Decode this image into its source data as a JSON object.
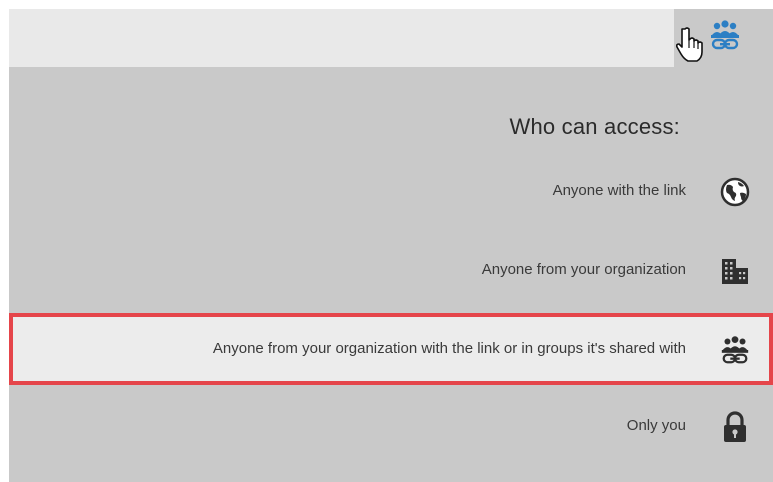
{
  "header": {
    "sharing_icon": "group-link-icon",
    "accent": "#2c7fc4"
  },
  "panel": {
    "heading": "Who can access:",
    "options": [
      {
        "label": "Anyone with the link",
        "icon": "globe-icon",
        "selected": false
      },
      {
        "label": "Anyone from your organization",
        "icon": "building-icon",
        "selected": false
      },
      {
        "label": "Anyone from your organization with the link or in groups it's shared with",
        "icon": "group-link-icon",
        "selected": true
      },
      {
        "label": "Only you",
        "icon": "lock-icon",
        "selected": false
      }
    ]
  },
  "colors": {
    "panel_bg": "#c9c9c9",
    "selected_bg": "#ececec",
    "selected_border": "#e5454a",
    "icon_dark": "#2f2f2f"
  }
}
